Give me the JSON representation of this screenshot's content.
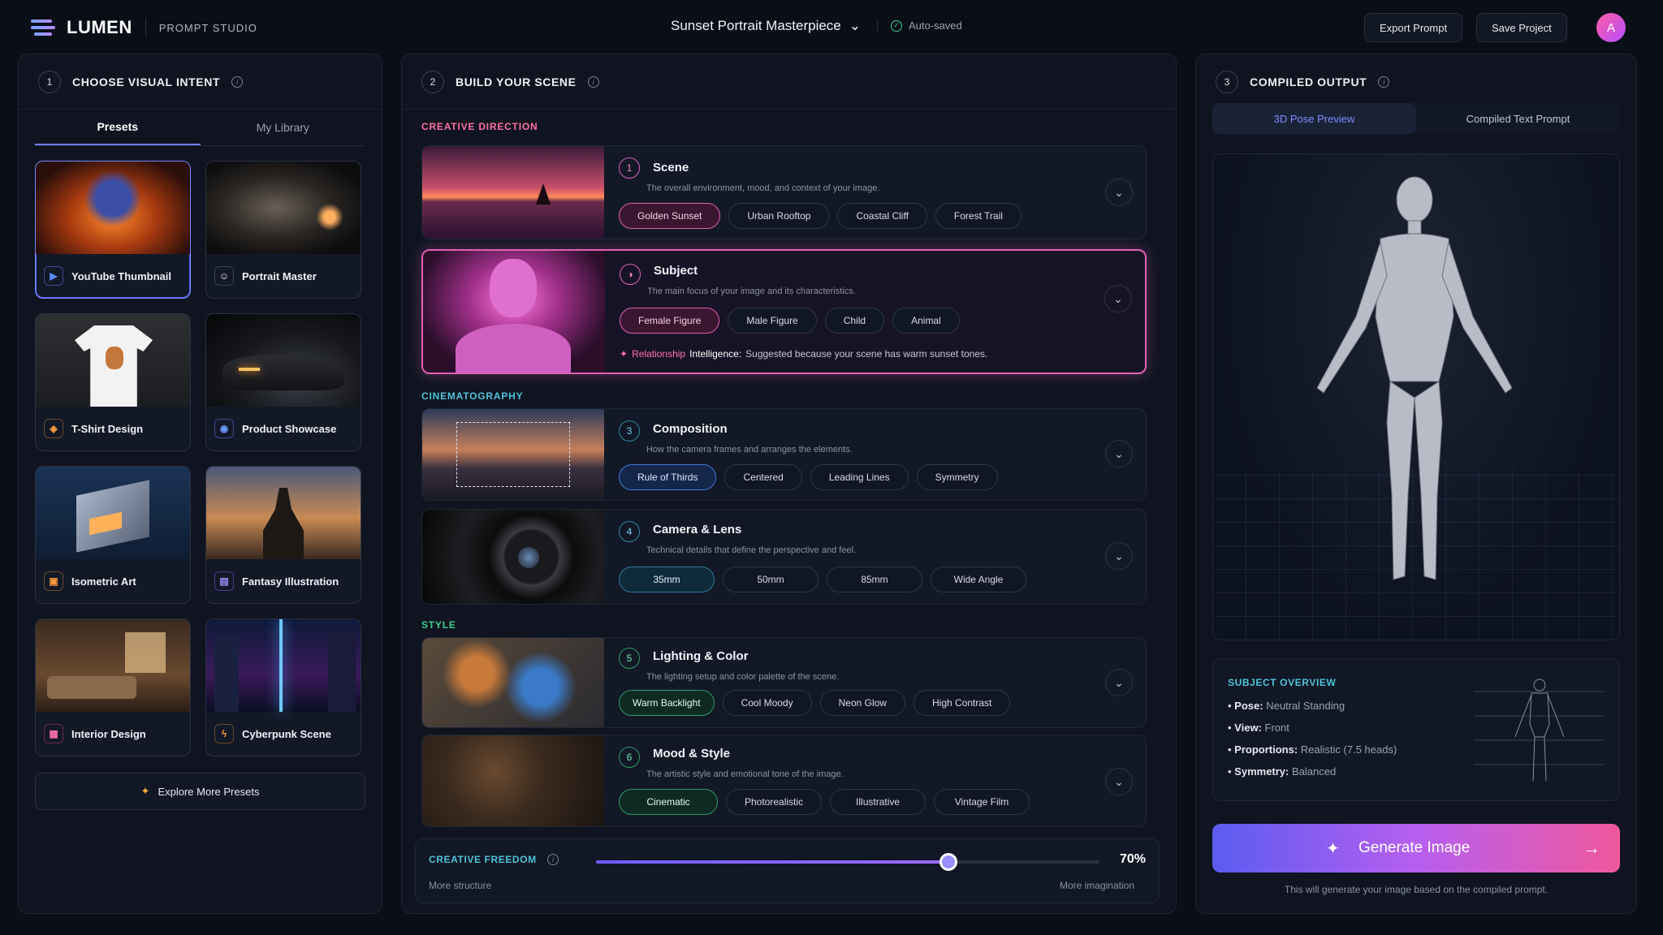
{
  "app": {
    "brand": "LUMEN",
    "section": "PROMPT STUDIO",
    "project": "Sunset Portrait Masterpiece",
    "saved": "Auto-saved",
    "export": "Export Prompt",
    "save": "Save Project",
    "avatar": "A"
  },
  "left": {
    "num": "1",
    "title": "CHOOSE VISUAL INTENT",
    "tabs": [
      "Presets",
      "My Library"
    ],
    "cards": [
      {
        "label": "YouTube Thumbnail",
        "icon": "play-icon"
      },
      {
        "label": "Portrait Master",
        "icon": "person-icon"
      },
      {
        "label": "T-Shirt Design",
        "icon": "shirt-icon"
      },
      {
        "label": "Product Showcase",
        "icon": "globe-icon"
      },
      {
        "label": "Isometric Art",
        "icon": "cube-icon"
      },
      {
        "label": "Fantasy Illustration",
        "icon": "book-icon"
      },
      {
        "label": "Interior Design",
        "icon": "sofa-icon"
      },
      {
        "label": "Cyberpunk Scene",
        "icon": "bolt-icon"
      }
    ],
    "explore": "Explore More Presets"
  },
  "mid": {
    "num": "2",
    "title": "BUILD YOUR SCENE",
    "sections": [
      "CREATIVE DIRECTION",
      "CINEMATOGRAPHY",
      "STYLE"
    ],
    "rows": [
      {
        "num": "1",
        "title": "Scene",
        "desc": "The overall environment, mood, and context of your image.",
        "chips": [
          "Golden Sunset",
          "Urban Rooftop",
          "Coastal Cliff",
          "Forest Trail"
        ]
      },
      {
        "num": "",
        "title": "Subject",
        "desc": "The main focus of your image and its characteristics.",
        "chips": [
          "Female Figure",
          "Male Figure",
          "Child",
          "Animal"
        ],
        "hint_a": "Relationship",
        "hint_b": "Intelligence:",
        "hint_c": "Suggested because your scene has warm sunset tones."
      },
      {
        "num": "3",
        "title": "Composition",
        "desc": "How the camera frames and arranges the elements.",
        "chips": [
          "Rule of Thirds",
          "Centered",
          "Leading Lines",
          "Symmetry"
        ]
      },
      {
        "num": "4",
        "title": "Camera & Lens",
        "desc": "Technical details that define the perspective and feel.",
        "chips": [
          "35mm",
          "50mm",
          "85mm",
          "Wide Angle"
        ]
      },
      {
        "num": "5",
        "title": "Lighting & Color",
        "desc": "The lighting setup and color palette of the scene.",
        "chips": [
          "Warm Backlight",
          "Cool Moody",
          "Neon Glow",
          "High Contrast"
        ]
      },
      {
        "num": "6",
        "title": "Mood & Style",
        "desc": "The artistic style and emotional tone of the image.",
        "chips": [
          "Cinematic",
          "Photorealistic",
          "Illustrative",
          "Vintage Film"
        ]
      }
    ],
    "freedom": {
      "label": "CREATIVE FREEDOM",
      "value": "70%",
      "level": 0.7,
      "left": "More structure",
      "right": "More imagination"
    }
  },
  "right": {
    "num": "3",
    "title": "COMPILED OUTPUT",
    "tabs": [
      "3D Pose Preview",
      "Compiled Text Prompt"
    ],
    "overview": {
      "title": "SUBJECT OVERVIEW",
      "items": [
        {
          "k": "Pose:",
          "v": "Neutral Standing"
        },
        {
          "k": "View:",
          "v": "Front"
        },
        {
          "k": "Proportions:",
          "v": "Realistic (7.5 heads)"
        },
        {
          "k": "Symmetry:",
          "v": "Balanced"
        }
      ]
    },
    "generate": "Generate Image",
    "note": "This will generate your image based on the compiled prompt."
  },
  "colors": {
    "accent": "#6f7dff",
    "pink": "#e260b6",
    "green": "#3fcf8e",
    "cyan": "#4fc3d9"
  }
}
